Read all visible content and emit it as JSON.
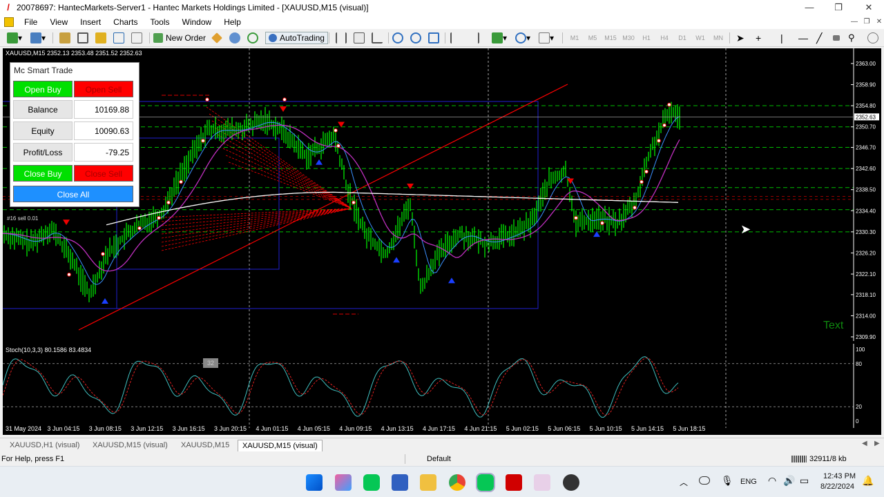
{
  "window": {
    "title": "20078697: HantecMarkets-Server1 - Hantec Markets Holdings Limited - [XAUUSD,M15 (visual)]",
    "minimize": "—",
    "restore": "❐",
    "close": "✕"
  },
  "menu": [
    "File",
    "View",
    "Insert",
    "Charts",
    "Tools",
    "Window",
    "Help"
  ],
  "toolbar": {
    "new_order_label": "New Order",
    "autotrading_label": "AutoTrading",
    "timeframes": [
      "M1",
      "M5",
      "M15",
      "M30",
      "H1",
      "H4",
      "D1",
      "W1",
      "MN"
    ]
  },
  "chart": {
    "symbol_line": "XAUUSD,M15  2352.13 2353.48 2351.52 2352.63",
    "stoch_line": "Stoch(10,3,3) 80.1586 83.4834",
    "trade_label": "#16 sell 0.01",
    "text_object": "Text",
    "stoch_marker": "32",
    "price_labels": [
      "2363.00",
      "2358.90",
      "2354.80",
      "2350.70",
      "2346.70",
      "2342.60",
      "2338.50",
      "2334.40",
      "2330.30",
      "2326.20",
      "2322.10",
      "2318.10",
      "2314.00",
      "2309.90"
    ],
    "current_price": "2352.63",
    "stoch_levels": [
      "100",
      "80",
      "20",
      "0"
    ],
    "time_labels": [
      "31 May 2024",
      "3 Jun 04:15",
      "3 Jun 08:15",
      "3 Jun 12:15",
      "3 Jun 16:15",
      "3 Jun 20:15",
      "4 Jun 01:15",
      "4 Jun 05:15",
      "4 Jun 09:15",
      "4 Jun 13:15",
      "4 Jun 17:15",
      "4 Jun 21:15",
      "5 Jun 02:15",
      "5 Jun 06:15",
      "5 Jun 10:15",
      "5 Jun 14:15",
      "5 Jun 18:15"
    ]
  },
  "panel": {
    "title": "Mc Smart Trade",
    "open_buy": "Open Buy",
    "open_sell": "Open Sell",
    "balance_label": "Balance",
    "balance_value": "10169.88",
    "equity_label": "Equity",
    "equity_value": "10090.63",
    "pl_label": "Profit/Loss",
    "pl_value": "-79.25",
    "close_buy": "Close Buy",
    "close_sell": "Close Sell",
    "close_all": "Close All"
  },
  "tabs": [
    "XAUUSD,H1 (visual)",
    "XAUUSD,M15 (visual)",
    "XAUUSD,M15",
    "XAUUSD,M15 (visual)"
  ],
  "status": {
    "help": "For Help, press F1",
    "profile": "Default",
    "traffic": "32911/8 kb"
  },
  "tray": {
    "lang": "ENG",
    "time": "12:43 PM",
    "date": "8/22/2024"
  },
  "colors": {
    "candle": "#00ff00",
    "ma_blue": "#3b8fff",
    "ma_magenta": "#c030c0",
    "ma_white": "#ffffff",
    "level_green": "#00c000",
    "trend_red": "#ff0000"
  }
}
